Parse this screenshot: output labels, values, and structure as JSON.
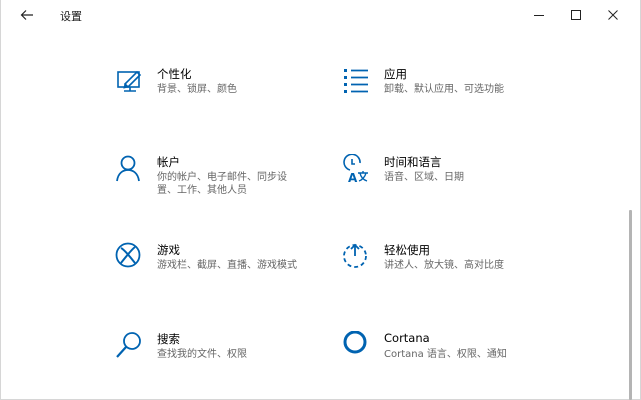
{
  "window": {
    "title": "设置"
  },
  "tiles": [
    {
      "name": "个性化",
      "desc_lines": [
        "背景、锁屏、颜色"
      ],
      "icon": "personalization-icon"
    },
    {
      "name": "应用",
      "desc_lines": [
        "卸载、默认应用、可选功能"
      ],
      "icon": "apps-icon"
    },
    {
      "name": "帐户",
      "desc_lines": [
        "你的帐户、电子邮件、同步设",
        "置、工作、其他人员"
      ],
      "icon": "account-icon"
    },
    {
      "name": "时间和语言",
      "desc_lines": [
        "语音、区域、日期"
      ],
      "icon": "time-language-icon"
    },
    {
      "name": "游戏",
      "desc_lines": [
        "游戏栏、截屏、直播、游戏模式"
      ],
      "icon": "xbox-icon"
    },
    {
      "name": "轻松使用",
      "desc_lines": [
        "讲述人、放大镜、高对比度"
      ],
      "icon": "ease-of-access-icon"
    },
    {
      "name": "搜索",
      "desc_lines": [
        "查找我的文件、权限"
      ],
      "icon": "search-icon"
    },
    {
      "name": "Cortana",
      "desc_lines": [
        "Cortana 语言、权限、通知"
      ],
      "icon": "cortana-icon"
    }
  ],
  "colors": {
    "accent": "#0063b1",
    "text": "#000000",
    "subtext": "#666666"
  }
}
